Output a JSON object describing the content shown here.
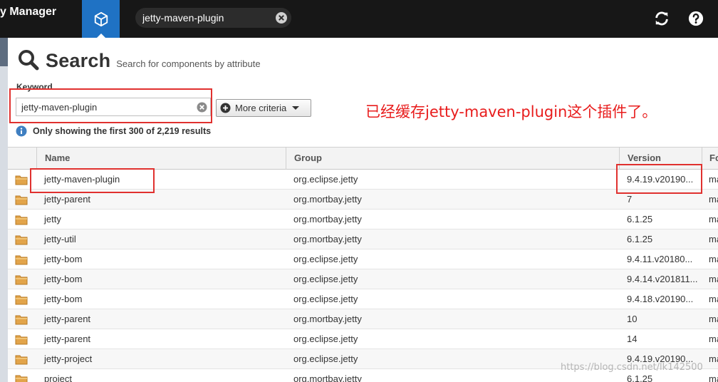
{
  "topbar": {
    "brand": "y Manager",
    "search_value": "jetty-maven-plugin",
    "icons": {
      "browse": "cube-icon",
      "clear": "clear-icon",
      "refresh": "refresh-icon",
      "help": "help-icon"
    },
    "colors": {
      "bar": "#171717",
      "browse_active": "#1f72c4"
    }
  },
  "search": {
    "title": "Search",
    "subtitle": "Search for components by attribute",
    "keyword_label": "Keyword",
    "keyword_value": "jetty-maven-plugin",
    "more_criteria_label": "More criteria",
    "results_info": "Only showing the first 300 of 2,219 results"
  },
  "annotation": {
    "text": "已经缓存jetty-maven-plugin这个插件了。",
    "color": "#e81c1c"
  },
  "table": {
    "columns": [
      "Name",
      "Group",
      "Version",
      "Fo"
    ],
    "rows": [
      {
        "name": "jetty-maven-plugin",
        "group": "org.eclipse.jetty",
        "version": "9.4.19.v20190...",
        "format": "ma"
      },
      {
        "name": "jetty-parent",
        "group": "org.mortbay.jetty",
        "version": "7",
        "format": "ma"
      },
      {
        "name": "jetty",
        "group": "org.mortbay.jetty",
        "version": "6.1.25",
        "format": "ma"
      },
      {
        "name": "jetty-util",
        "group": "org.mortbay.jetty",
        "version": "6.1.25",
        "format": "ma"
      },
      {
        "name": "jetty-bom",
        "group": "org.eclipse.jetty",
        "version": "9.4.11.v20180...",
        "format": "ma"
      },
      {
        "name": "jetty-bom",
        "group": "org.eclipse.jetty",
        "version": "9.4.14.v201811...",
        "format": "ma"
      },
      {
        "name": "jetty-bom",
        "group": "org.eclipse.jetty",
        "version": "9.4.18.v20190...",
        "format": "ma"
      },
      {
        "name": "jetty-parent",
        "group": "org.mortbay.jetty",
        "version": "10",
        "format": "ma"
      },
      {
        "name": "jetty-parent",
        "group": "org.eclipse.jetty",
        "version": "14",
        "format": "ma"
      },
      {
        "name": "jetty-project",
        "group": "org.eclipse.jetty",
        "version": "9.4.19.v20190...",
        "format": "ma"
      },
      {
        "name": "project",
        "group": "org.mortbay.jetty",
        "version": "6.1.25",
        "format": "ma"
      }
    ],
    "row_icon": "folder-icon"
  },
  "watermark": "https://blog.csdn.net/lk142500"
}
